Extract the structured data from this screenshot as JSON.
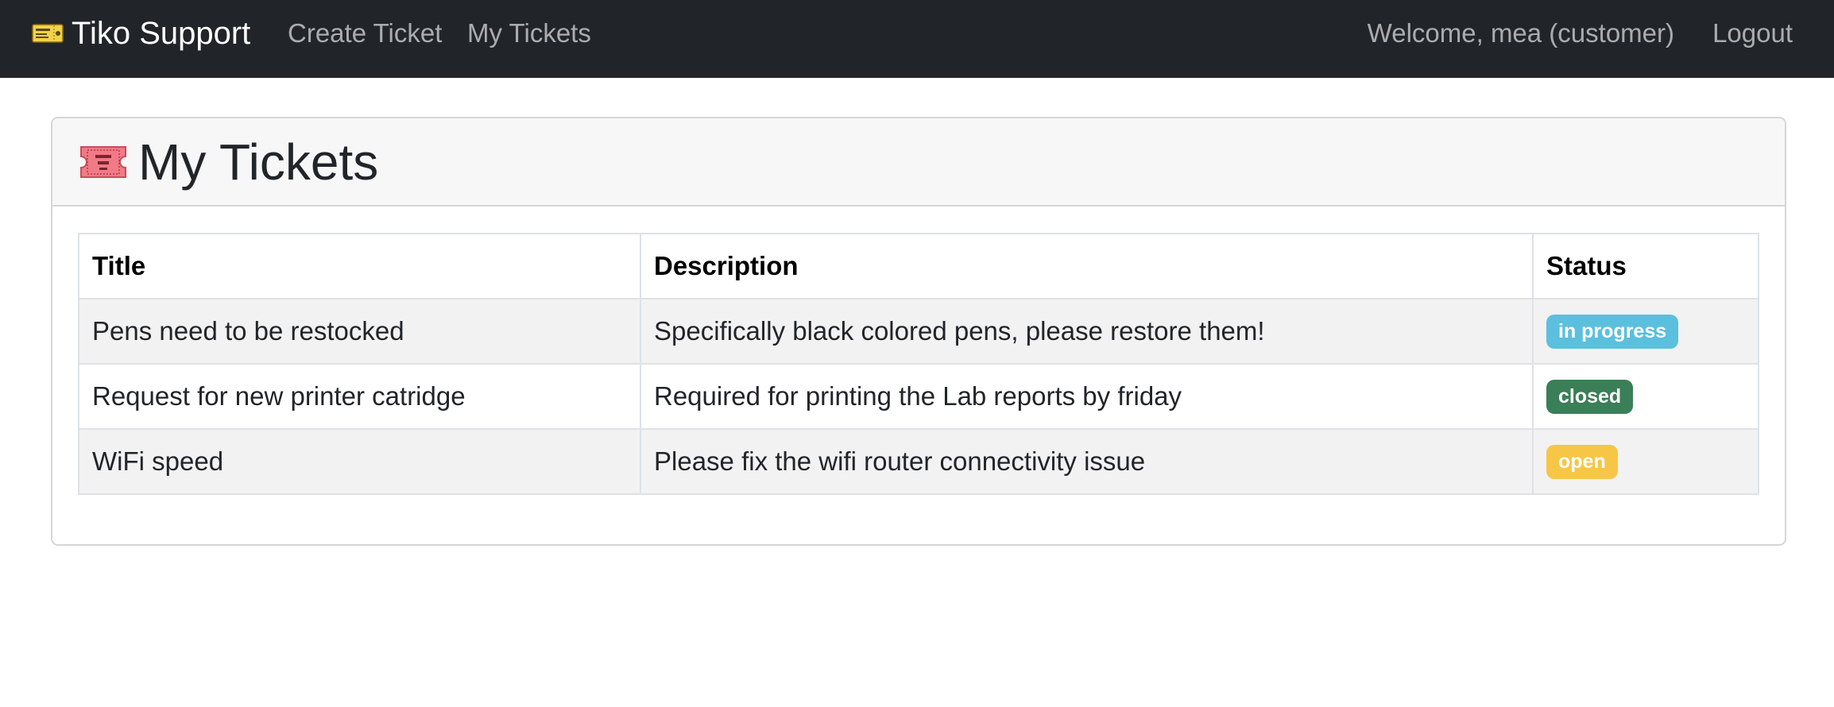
{
  "navbar": {
    "brand_icon": "ticket-icon",
    "brand": "Tiko Support",
    "links": {
      "create_ticket": "Create Ticket",
      "my_tickets": "My Tickets"
    },
    "welcome": "Welcome, mea (customer)",
    "logout": "Logout"
  },
  "page": {
    "title_icon": "admit-one-ticket-icon",
    "title": "My Tickets"
  },
  "table": {
    "headers": {
      "title": "Title",
      "description": "Description",
      "status": "Status"
    },
    "rows": [
      {
        "title": "Pens need to be restocked",
        "description": "Specifically black colored pens, please restore them!",
        "status": "in progress",
        "status_color": "#5bc0de"
      },
      {
        "title": "Request for new printer catridge",
        "description": "Required for printing the Lab reports by friday",
        "status": "closed",
        "status_color": "#3a7f57"
      },
      {
        "title": "WiFi speed",
        "description": "Please fix the wifi router connectivity issue",
        "status": "open",
        "status_color": "#f8c646"
      }
    ]
  },
  "colors": {
    "navbar_bg": "#212529",
    "card_header_bg": "#f7f7f7",
    "stripe_bg": "#f2f2f2"
  }
}
